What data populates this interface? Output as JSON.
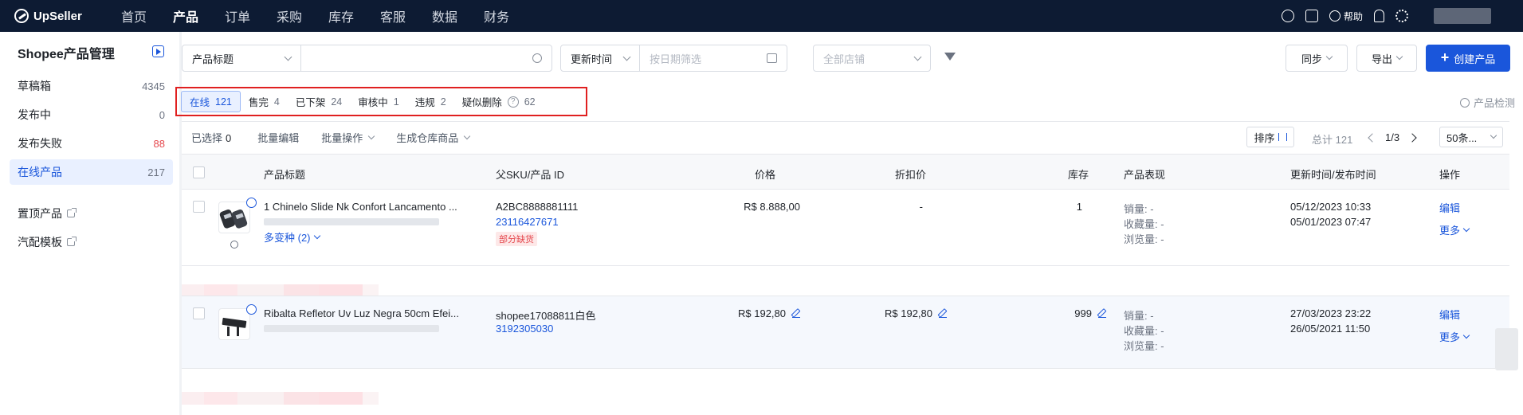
{
  "brand": "UpSeller",
  "nav": {
    "items": [
      "首页",
      "产品",
      "订单",
      "采购",
      "库存",
      "客服",
      "数据",
      "财务"
    ],
    "active_index": 1,
    "help_label": "帮助"
  },
  "sidebar": {
    "title": "Shopee产品管理",
    "items": [
      {
        "label": "草稿箱",
        "count": "4345"
      },
      {
        "label": "发布中",
        "count": "0"
      },
      {
        "label": "发布失败",
        "count": "88"
      },
      {
        "label": "在线产品",
        "count": "217"
      }
    ],
    "links": [
      "置顶产品",
      "汽配模板"
    ]
  },
  "filters": {
    "title_select": "产品标题",
    "search_placeholder": "",
    "time_select": "更新时间",
    "date_placeholder": "按日期筛选",
    "store_placeholder": "全部店铺"
  },
  "actions": {
    "sync": "同步",
    "export": "导出",
    "create": "创建产品"
  },
  "tabs": [
    {
      "label": "在线",
      "count": "121"
    },
    {
      "label": "售完",
      "count": "4"
    },
    {
      "label": "已下架",
      "count": "24"
    },
    {
      "label": "审核中",
      "count": "1"
    },
    {
      "label": "违规",
      "count": "2"
    },
    {
      "label": "疑似删除",
      "count": "62"
    }
  ],
  "detect_label": "产品检测",
  "toolbar": {
    "selected_label": "已选择",
    "selected_count": "0",
    "batch_edit": "批量编辑",
    "batch_ops": "批量操作",
    "gen_warehouse": "生成仓库商品",
    "sort": "排序",
    "total": "总计 121",
    "page": "1/3",
    "page_size": "50条..."
  },
  "columns": {
    "title": "产品标题",
    "sku": "父SKU/产品 ID",
    "price": "价格",
    "discount": "折扣价",
    "stock": "库存",
    "performance": "产品表现",
    "time": "更新时间/发布时间",
    "ops": "操作"
  },
  "rows": [
    {
      "title": "1 Chinelo Slide Nk Confort Lancamento ...",
      "variants": "多变种 (2)",
      "sku": "A2BC8888881111",
      "product_id": "23116427671",
      "tag": "部分缺货",
      "price": "R$ 8.888,00",
      "discount": "-",
      "stock": "1",
      "sales": "销量: -",
      "favs": "收藏量: -",
      "views": "浏览量: -",
      "updated": "05/12/2023 10:33",
      "published": "05/01/2023 07:47",
      "edit": "编辑",
      "more": "更多"
    },
    {
      "title": "Ribalta Refletor Uv Luz Negra 50cm Efei...",
      "sku": "shopee17088811白色",
      "product_id": "3192305030",
      "price": "R$ 192,80",
      "discount": "R$ 192,80",
      "stock": "999",
      "sales": "销量: -",
      "favs": "收藏量: -",
      "views": "浏览量: -",
      "updated": "27/03/2023 23:22",
      "published": "26/05/2021 11:50",
      "edit": "编辑",
      "more": "更多"
    }
  ],
  "colors": {
    "nav_bg": "#0d1b33",
    "primary": "#1a56db",
    "highlight_border": "#e02020",
    "danger": "#e5484d"
  }
}
